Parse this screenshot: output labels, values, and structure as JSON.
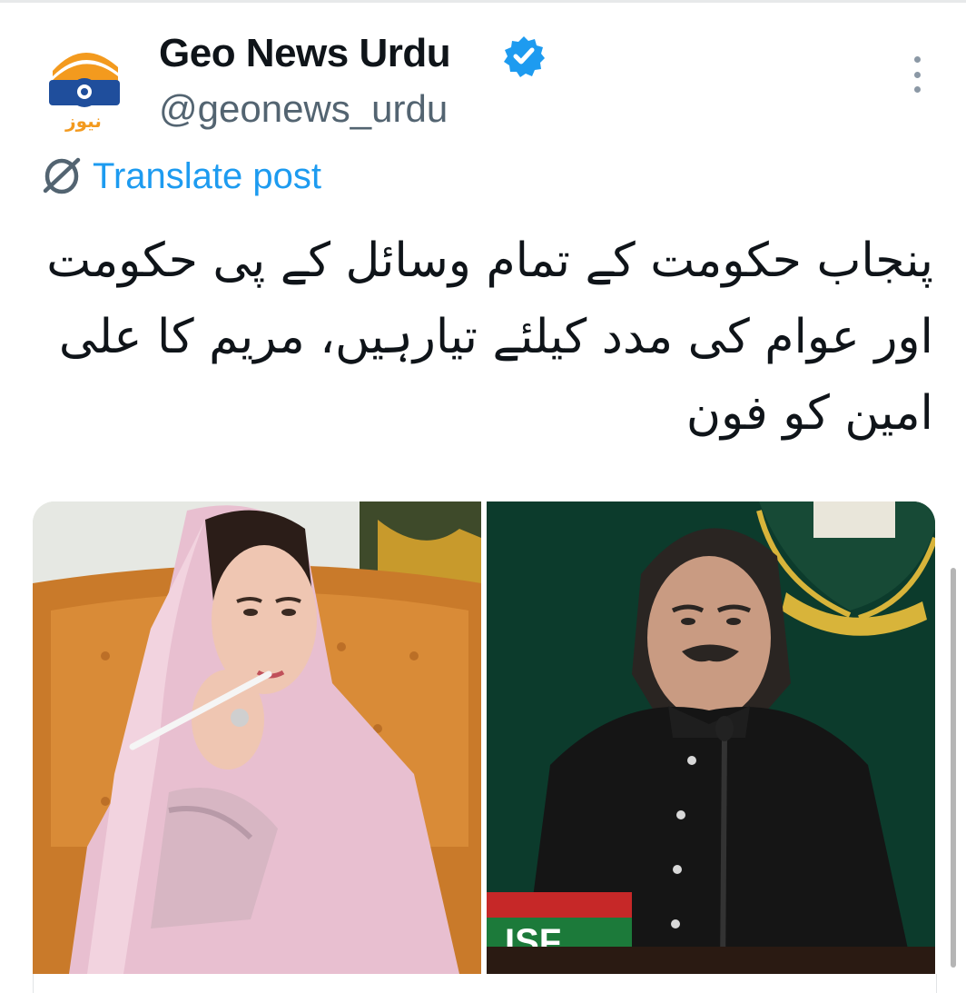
{
  "post": {
    "author": {
      "display_name": "Geo News Urdu",
      "handle": "@geonews_urdu",
      "verified": true,
      "avatar_icon": "geo-news-logo-icon",
      "avatar_logo_text": "نیوز"
    },
    "translate_label": "Translate post",
    "text_lines": [
      "پنجاب حکومت کے تمام وسائل کے پی حکومت",
      "اور عوام کی مدد کیلئے تیارہیں، مریم کا علی",
      "امین کو فون"
    ],
    "media": {
      "count": 2,
      "right_photo_podium_text": "ISF"
    }
  },
  "colors": {
    "accent": "#1d9bf0",
    "text": "#0f1419",
    "secondary_text": "#536471",
    "verified_badge": "#1d9bf0",
    "logo_orange": "#f39a1e",
    "logo_blue": "#1f4e9c"
  },
  "icons": {
    "verified": "verified-badge-icon",
    "translate": "globe-slash-icon",
    "more": "more-options-icon"
  }
}
